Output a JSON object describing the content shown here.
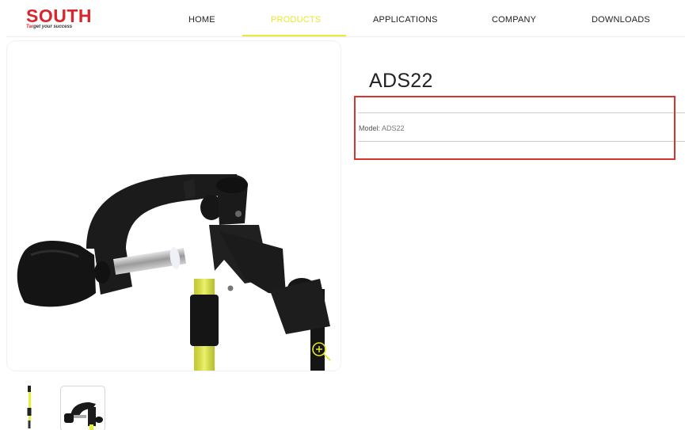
{
  "brand": {
    "name": "SOUTH",
    "tagline_prefix": "Tar",
    "tagline_rest": "get your success"
  },
  "nav": {
    "items": [
      {
        "label": "HOME",
        "active": false
      },
      {
        "label": "PRODUCTS",
        "active": true
      },
      {
        "label": "APPLICATIONS",
        "active": false
      },
      {
        "label": "COMPANY",
        "active": false
      },
      {
        "label": "DOWNLOADS",
        "active": false
      }
    ]
  },
  "product": {
    "title": "ADS22",
    "model_label": "Model:",
    "model_value": "ADS22"
  },
  "icons": {
    "zoom": "zoom-in-icon"
  },
  "colors": {
    "brand_red": "#d9262c",
    "accent_yellow": "#ede93a",
    "highlight_red": "#d8342c"
  }
}
